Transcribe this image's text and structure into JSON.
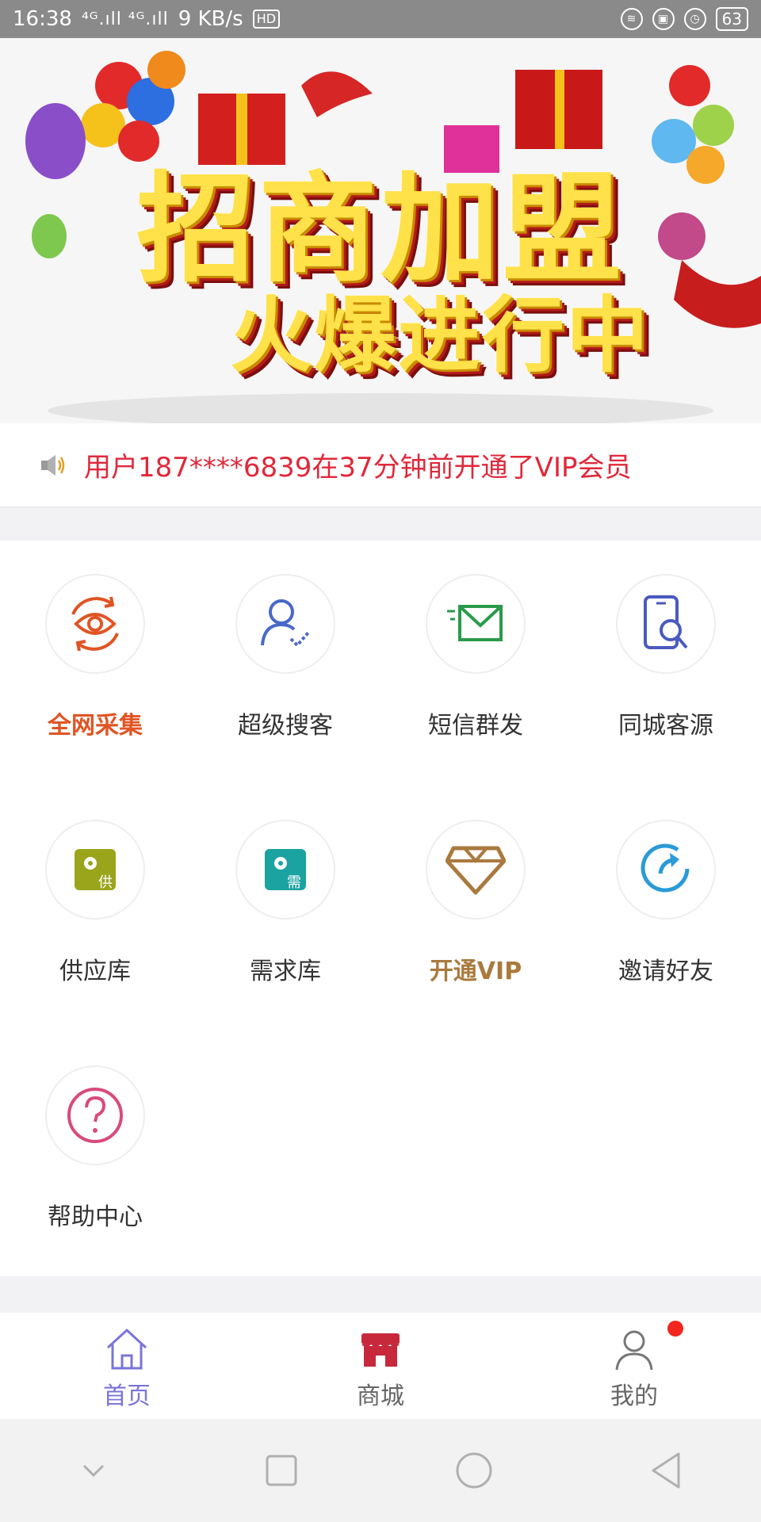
{
  "status_bar": {
    "time": "16:38",
    "signal": "⁴ᴳ.ıll ⁴ᴳ.ıll",
    "speed": "9 KB/s",
    "hd": "HD",
    "battery": "63"
  },
  "banner": {
    "line1": "招商加盟",
    "line2": "火爆进行中"
  },
  "notice": {
    "icon": "speaker-icon",
    "text": "用户187****6839在37分钟前开通了VIP会员",
    "color": "#e0283a"
  },
  "grid": {
    "items": [
      {
        "label": "全网采集",
        "icon": "eye-refresh-icon"
      },
      {
        "label": "超级搜客",
        "icon": "user-check-icon"
      },
      {
        "label": "短信群发",
        "icon": "mail-icon"
      },
      {
        "label": "同城客源",
        "icon": "phone-search-icon"
      },
      {
        "label": "供应库",
        "icon": "supply-gear-icon"
      },
      {
        "label": "需求库",
        "icon": "demand-gear-icon"
      },
      {
        "label": "开通VIP",
        "icon": "diamond-icon"
      },
      {
        "label": "邀请好友",
        "icon": "share-arrow-icon"
      },
      {
        "label": "帮助中心",
        "icon": "question-icon"
      }
    ]
  },
  "tabbar": {
    "tabs": [
      {
        "label": "首页",
        "icon": "home-icon",
        "active": true
      },
      {
        "label": "商城",
        "icon": "store-icon",
        "active": false
      },
      {
        "label": "我的",
        "icon": "profile-icon",
        "active": false
      }
    ],
    "active_color": "#7a74d8"
  },
  "colors": {
    "accent_red": "#e05423",
    "vip_gold": "#a97a3e"
  }
}
